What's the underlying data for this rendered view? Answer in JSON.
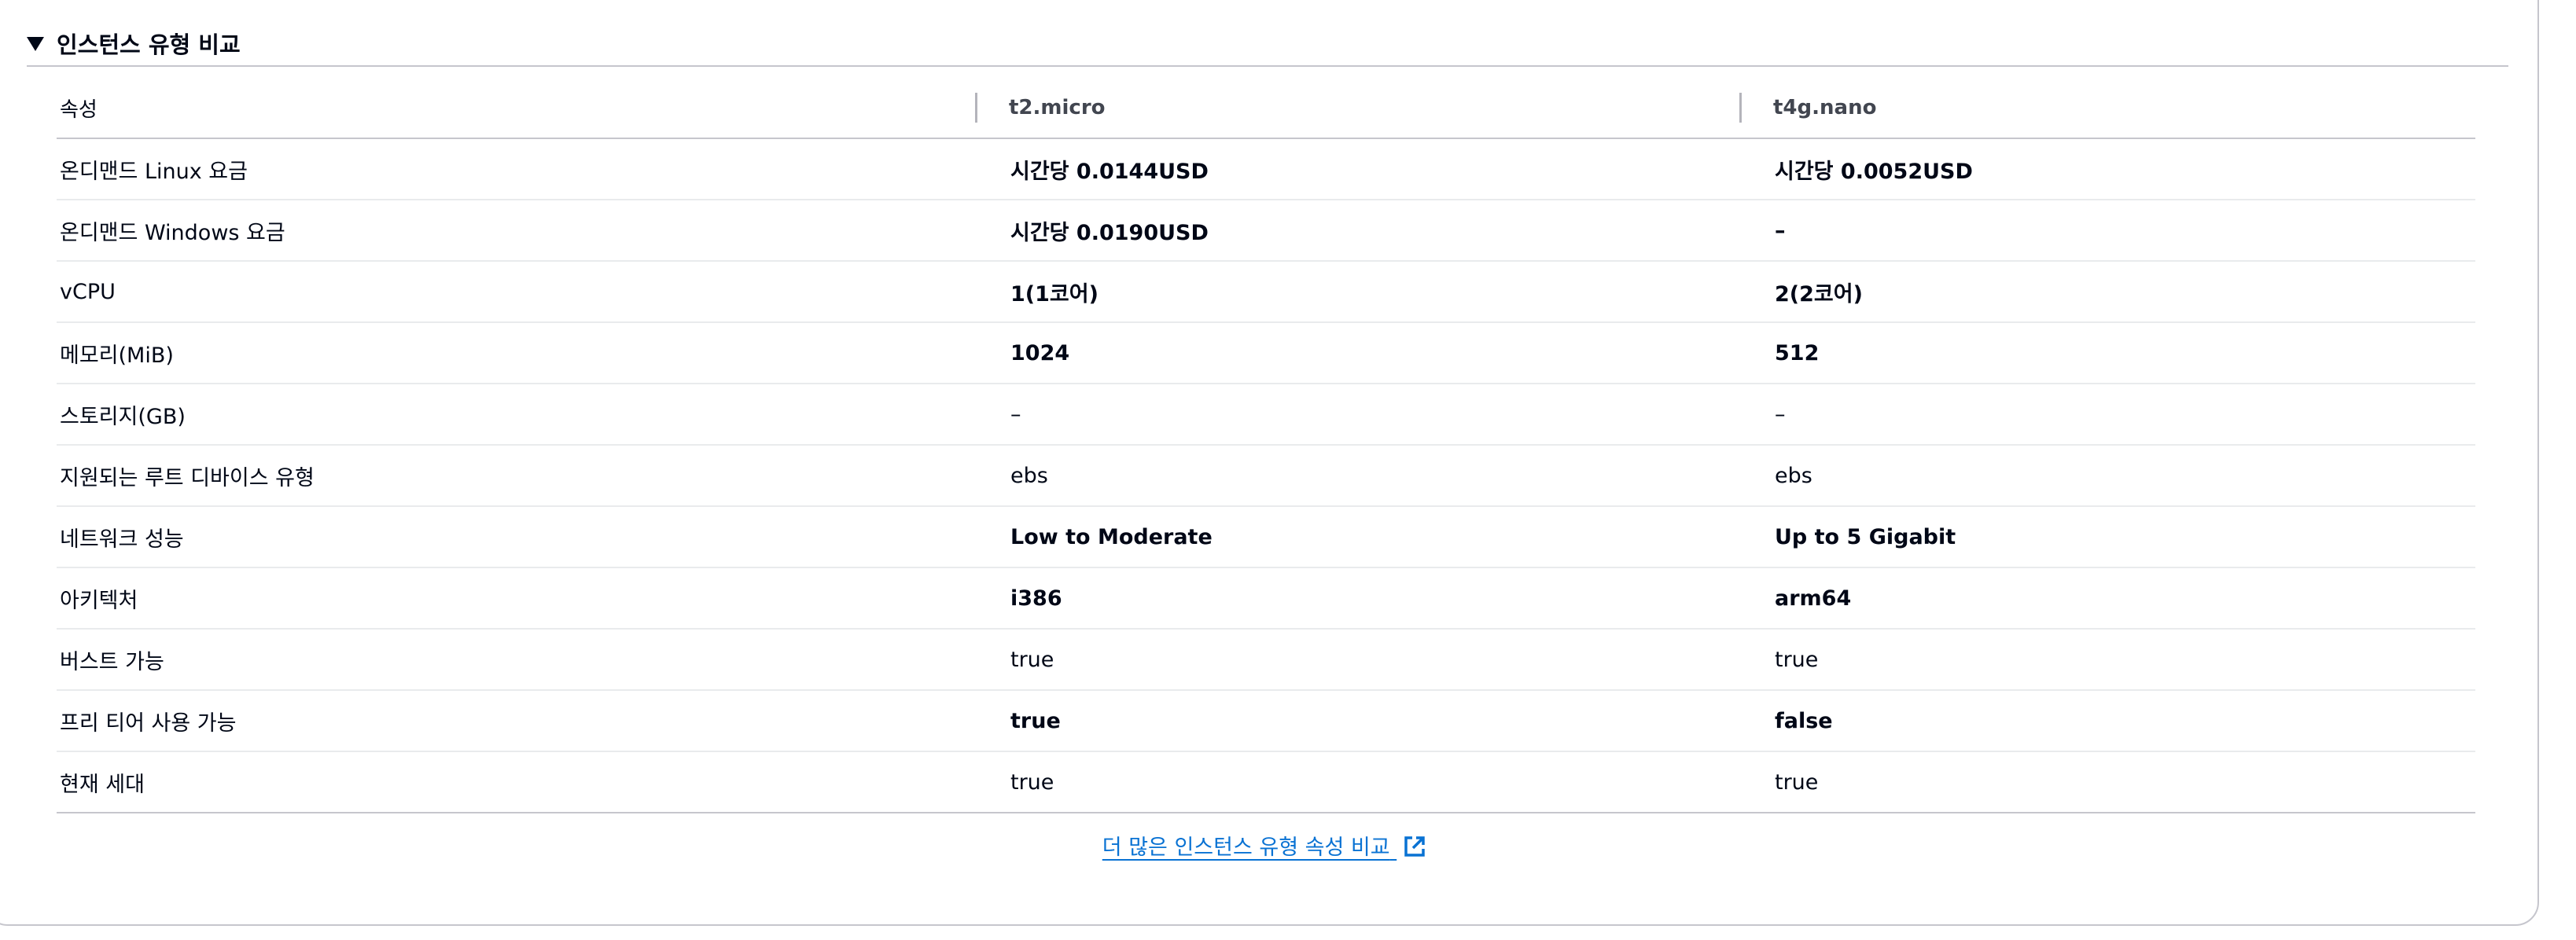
{
  "section": {
    "title": "인스턴스 유형 비교"
  },
  "table": {
    "headers": [
      "속성",
      "t2.micro",
      "t4g.nano"
    ],
    "rows": [
      {
        "label": "온디맨드 Linux 요금",
        "a": "시간당 0.0144USD",
        "b": "시간당 0.0052USD",
        "bold": true
      },
      {
        "label": "온디맨드 Windows 요금",
        "a": "시간당 0.0190USD",
        "b": "–",
        "bold": true
      },
      {
        "label": "vCPU",
        "a": "1(1코어)",
        "b": "2(2코어)",
        "bold": true
      },
      {
        "label": "메모리(MiB)",
        "a": "1024",
        "b": "512",
        "bold": true
      },
      {
        "label": "스토리지(GB)",
        "a": "–",
        "b": "–",
        "bold": false
      },
      {
        "label": "지원되는 루트 디바이스 유형",
        "a": "ebs",
        "b": "ebs",
        "bold": false
      },
      {
        "label": "네트워크 성능",
        "a": "Low to Moderate",
        "b": "Up to 5 Gigabit",
        "bold": true
      },
      {
        "label": "아키텍처",
        "a": "i386",
        "b": "arm64",
        "bold": true
      },
      {
        "label": "버스트 가능",
        "a": "true",
        "b": "true",
        "bold": false
      },
      {
        "label": "프리 티어 사용 가능",
        "a": "true",
        "b": "false",
        "bold": true
      },
      {
        "label": "현재 세대",
        "a": "true",
        "b": "true",
        "bold": false
      }
    ]
  },
  "footer": {
    "link_text": "더 많은 인스턴스 유형 속성 비교",
    "link_icon": "external-link-icon"
  },
  "colors": {
    "text": "#000716",
    "header_text": "#424650",
    "link": "#0972d3",
    "divider": "#c6c6cd",
    "row_divider": "#e9ebed"
  }
}
